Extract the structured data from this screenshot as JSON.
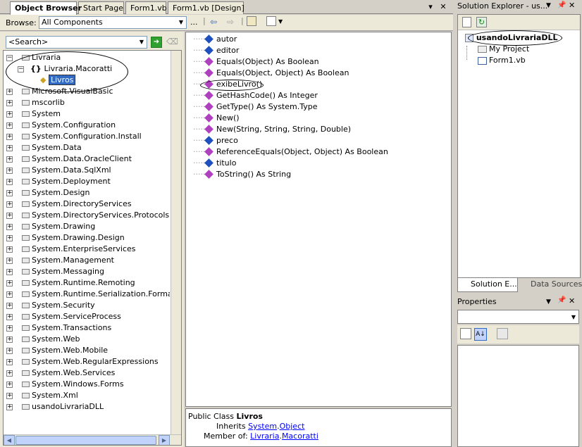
{
  "tabs": [
    "Object Browser",
    "Start Page",
    "Form1.vb",
    "Form1.vb [Design]"
  ],
  "browse": {
    "label": "Browse:",
    "value": "All Components",
    "dots": "..."
  },
  "search": {
    "placeholder": "<Search>"
  },
  "tree": [
    {
      "label": "Livraria",
      "expand": "−"
    },
    {
      "label": "Livraria.Macoratti",
      "expand": "−"
    },
    {
      "label": "Livros",
      "expand": ""
    },
    {
      "label": "Microsoft.VisualBasic",
      "expand": "+"
    },
    {
      "label": "mscorlib",
      "expand": "+"
    },
    {
      "label": "System",
      "expand": "+"
    },
    {
      "label": "System.Configuration",
      "expand": "+"
    },
    {
      "label": "System.Configuration.Install",
      "expand": "+"
    },
    {
      "label": "System.Data",
      "expand": "+"
    },
    {
      "label": "System.Data.OracleClient",
      "expand": "+"
    },
    {
      "label": "System.Data.SqlXml",
      "expand": "+"
    },
    {
      "label": "System.Deployment",
      "expand": "+"
    },
    {
      "label": "System.Design",
      "expand": "+"
    },
    {
      "label": "System.DirectoryServices",
      "expand": "+"
    },
    {
      "label": "System.DirectoryServices.Protocols",
      "expand": "+"
    },
    {
      "label": "System.Drawing",
      "expand": "+"
    },
    {
      "label": "System.Drawing.Design",
      "expand": "+"
    },
    {
      "label": "System.EnterpriseServices",
      "expand": "+"
    },
    {
      "label": "System.Management",
      "expand": "+"
    },
    {
      "label": "System.Messaging",
      "expand": "+"
    },
    {
      "label": "System.Runtime.Remoting",
      "expand": "+"
    },
    {
      "label": "System.Runtime.Serialization.Formatters.Soap",
      "expand": "+"
    },
    {
      "label": "System.Security",
      "expand": "+"
    },
    {
      "label": "System.ServiceProcess",
      "expand": "+"
    },
    {
      "label": "System.Transactions",
      "expand": "+"
    },
    {
      "label": "System.Web",
      "expand": "+"
    },
    {
      "label": "System.Web.Mobile",
      "expand": "+"
    },
    {
      "label": "System.Web.RegularExpressions",
      "expand": "+"
    },
    {
      "label": "System.Web.Services",
      "expand": "+"
    },
    {
      "label": "System.Windows.Forms",
      "expand": "+"
    },
    {
      "label": "System.Xml",
      "expand": "+"
    },
    {
      "label": "usandoLivrariaDLL",
      "expand": "+"
    }
  ],
  "members": [
    {
      "label": "autor",
      "kind": "field"
    },
    {
      "label": "editor",
      "kind": "field"
    },
    {
      "label": "Equals(Object) As Boolean",
      "kind": "method"
    },
    {
      "label": "Equals(Object, Object) As Boolean",
      "kind": "method"
    },
    {
      "label": "exibeLivro()",
      "kind": "method"
    },
    {
      "label": "GetHashCode() As Integer",
      "kind": "method"
    },
    {
      "label": "GetType() As System.Type",
      "kind": "method"
    },
    {
      "label": "New()",
      "kind": "method"
    },
    {
      "label": "New(String, String, String, Double)",
      "kind": "method"
    },
    {
      "label": "preco",
      "kind": "field"
    },
    {
      "label": "ReferenceEquals(Object, Object) As Boolean",
      "kind": "method"
    },
    {
      "label": "titulo",
      "kind": "field"
    },
    {
      "label": "ToString() As String",
      "kind": "method"
    }
  ],
  "description": {
    "class_prefix": "Public Class ",
    "class_name": "Livros",
    "inherits_label": "Inherits ",
    "inherits_ns": "System",
    "inherits_type": "Object",
    "member_label": "Member of: ",
    "member_ns": "Livraria",
    "member_type": "Macoratti"
  },
  "solution_explorer": {
    "title": "Solution Explorer - us...",
    "project": "usandoLivrariaDLL",
    "items": [
      "My Project",
      "Form1.vb"
    ],
    "tabs": [
      "Solution E...",
      "Data Sources"
    ]
  },
  "properties": {
    "title": "Properties"
  },
  "colors": {
    "method": "#b040c0",
    "field": "#2050c0",
    "selection": "#316ac5"
  }
}
